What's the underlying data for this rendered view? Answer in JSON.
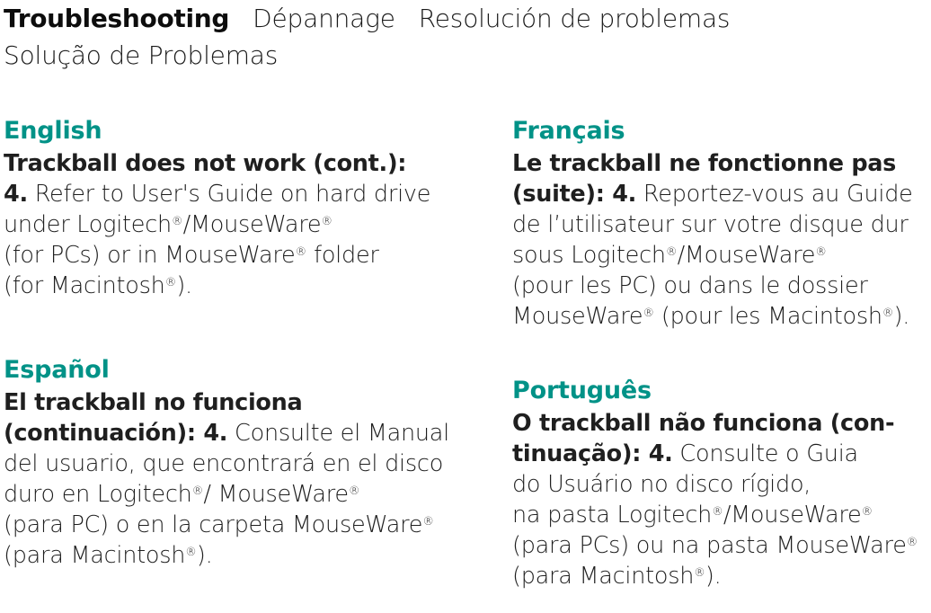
{
  "document": {
    "title": "Troubleshooting",
    "background_color": "#ffffff",
    "heading_color": "#009287",
    "body_color": "#1f1f1f"
  },
  "header": {
    "titles": [
      {
        "text": "Troubleshooting",
        "language": "English",
        "weight": "bold"
      },
      {
        "text": "Dépannage",
        "language": "Français",
        "weight": "light"
      },
      {
        "text": "Resolución de problemas",
        "language": "Español",
        "weight": "light"
      },
      {
        "text": "Solução de Problemas",
        "language": "Português",
        "weight": "light"
      }
    ],
    "line1": "Troubleshooting",
    "line1b": "Dépannage",
    "line1c": "Resolución de problemas",
    "line2": "Solução de Problemas"
  },
  "sections": {
    "english": {
      "heading": "English",
      "lines": [
        {
          "bold": "Trackball does not work (cont.):",
          "rest": ""
        },
        {
          "bold": "4.",
          "rest": " Refer to User's Guide on hard drive"
        },
        {
          "bold": "",
          "rest": "under Logitech®/MouseWare®"
        },
        {
          "bold": "",
          "rest": "(for PCs) or in MouseWare® folder"
        },
        {
          "bold": "",
          "rest": "(for Macintosh®)."
        }
      ],
      "full_text": "Trackball does not work (cont.): 4. Refer to User's Guide on hard drive under Logitech®/MouseWare® (for PCs) or in MouseWare® folder (for Macintosh®)."
    },
    "espanol": {
      "heading": "Español",
      "lines": [
        {
          "bold": "El trackball no funciona",
          "rest": ""
        },
        {
          "bold": "(continuación): 4.",
          "rest": " Consulte el Manual"
        },
        {
          "bold": "",
          "rest": "del usuario, que encontrará en el disco"
        },
        {
          "bold": "",
          "rest": "duro en Logitech®/ MouseWare®"
        },
        {
          "bold": "",
          "rest": "(para PC) o en la carpeta MouseWare®"
        },
        {
          "bold": "",
          "rest": "(para Macintosh®)."
        }
      ],
      "full_text": "El trackball no funciona (continuación): 4. Consulte el Manual del usuario, que encontrará en el disco duro en Logitech®/ MouseWare® (para PC) o en la carpeta MouseWare® (para Macintosh®)."
    },
    "francais": {
      "heading": "Français",
      "lines": [
        {
          "bold": "Le trackball ne fonctionne pas",
          "rest": ""
        },
        {
          "bold": "(suite): 4.",
          "rest": " Reportez-vous au Guide"
        },
        {
          "bold": "",
          "rest": "de l’utilisateur sur votre disque dur"
        },
        {
          "bold": "",
          "rest": "sous Logitech®/MouseWare®"
        },
        {
          "bold": "",
          "rest": "(pour les PC) ou dans le dossier"
        },
        {
          "bold": "",
          "rest": "MouseWare® (pour les Macintosh®)."
        }
      ],
      "full_text": "Le trackball ne fonctionne pas (suite): 4. Reportez-vous au Guide de l’utilisateur sur votre disque dur sous Logitech®/MouseWare® (pour les PC) ou dans le dossier MouseWare® (pour les Macintosh®)."
    },
    "portugues": {
      "heading": "Português",
      "lines": [
        {
          "bold": "O trackball não funciona (con-",
          "rest": ""
        },
        {
          "bold": "tinuação): 4.",
          "rest": " Consulte o Guia"
        },
        {
          "bold": "",
          "rest": "do Usuário no disco rígido,"
        },
        {
          "bold": "",
          "rest": "na pasta Logitech®/MouseWare®"
        },
        {
          "bold": "",
          "rest": "(para PCs) ou na pasta MouseWare®"
        },
        {
          "bold": "",
          "rest": "(para Macintosh®)."
        }
      ],
      "full_text": "O trackball não funciona (continuação): 4. Consulte o Guia do Usuário no disco rígido, na pasta Logitech®/MouseWare® (para PCs) ou na pasta MouseWare® (para Macintosh®)."
    }
  }
}
